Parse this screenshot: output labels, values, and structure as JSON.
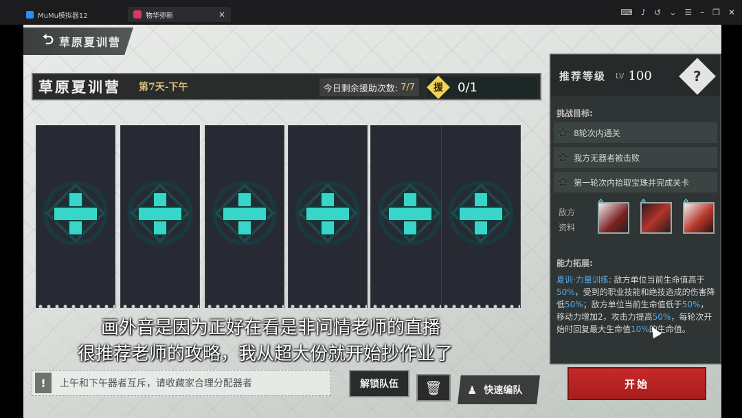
{
  "window": {
    "tab1_title": "MuMu模拟器12",
    "tab2_title": "物华弥新",
    "close_glyph": "×"
  },
  "game": {
    "back_label": "草原夏训营",
    "header": {
      "title": "草原夏训营",
      "day": "第7天-下午",
      "assist_label": "今日剩余援助次数:",
      "assist_count": "7/7",
      "help_badge": "援",
      "help_count": "0/1"
    },
    "slots": [
      {
        "name": "slot-1"
      },
      {
        "name": "slot-2"
      },
      {
        "name": "slot-3"
      },
      {
        "name": "slot-4"
      },
      {
        "name": "slot-5"
      },
      {
        "name": "slot-6"
      }
    ],
    "subtitles": {
      "line1": "画外音是因为正好在看是非问情老师的直播",
      "line2": "很推荐老师的攻略，我从超大份就开始抄作业了"
    },
    "tip": {
      "icon": "!",
      "text": "上午和下午器者互斥，请收藏家合理分配器者"
    },
    "buttons": {
      "unlock": "解锁队伍",
      "quick": "快速编队",
      "start": "开始"
    },
    "panel": {
      "rec_label": "推荐等级",
      "lv_prefix": "LV",
      "level": "100",
      "help_icon": "?",
      "goals_label": "挑战目标:",
      "goals": [
        "8轮次内通关",
        "我方无器者被击败",
        "第一轮次内拾取宝珠并完成关卡"
      ],
      "enemy_label": "敌方资料",
      "ability_label": "能力拓展:",
      "ability": {
        "key": "夏训·力量训练",
        "text1": ": 敌方单位当前生命值高于",
        "p1": "50%",
        "text2": "，受到的职业技能和绝技造成的伤害降低",
        "p2": "50%",
        "text3": "；敌方单位当前生命值低于",
        "p3": "50%",
        "text4": "，移动力增加2，攻击力提高",
        "p4": "50%",
        "text5": "，每轮次开始时回复最大生命值",
        "p5": "10%",
        "text6": "的生命值。"
      }
    }
  },
  "colors": {
    "accent_teal": "#38d6c8",
    "start_red": "#c62a2a",
    "highlight_blue": "#5aa7e6",
    "assist_yellow": "#f1c85d"
  }
}
